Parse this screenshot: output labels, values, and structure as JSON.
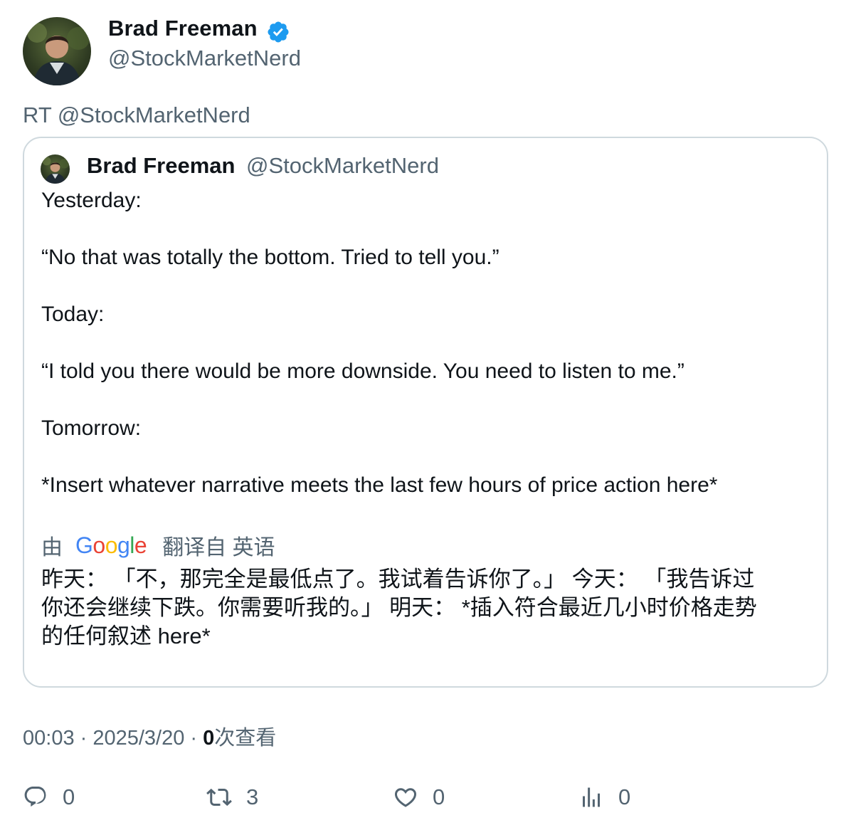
{
  "author": {
    "name": "Brad Freeman",
    "handle": "@StockMarketNerd",
    "verified": true
  },
  "retweet_label": "RT @StockMarketNerd",
  "quoted": {
    "name": "Brad Freeman",
    "handle": "@StockMarketNerd",
    "lines": [
      "Yesterday:",
      "“No that was totally the bottom. Tried to tell you.”",
      "Today:",
      "“I told you there would be more downside. You need to listen to me.”",
      "Tomorrow:",
      "*Insert whatever narrative meets the last few hours of price action here*"
    ],
    "translation": {
      "by_label": "由",
      "provider": "Google",
      "from_label": "翻译自 英语",
      "lines": [
        "昨天： 「不，那完全是最低点了。我试着告诉你了。」 今天： 「我告诉过",
        "你还会继续下跌。你需要听我的。」 明天： *插入符合最近几小时价格走势",
        "的任何叙述 here*"
      ]
    }
  },
  "meta": {
    "time": "00:03",
    "date": "2025/3/20",
    "views_count": "0",
    "views_label": "次查看"
  },
  "actions": {
    "reply_count": "0",
    "retweet_count": "3",
    "like_count": "0",
    "views_count": "0"
  },
  "colors": {
    "verified_badge": "#1d9bf0",
    "secondary_text": "#536471",
    "card_border": "#cfd9de"
  }
}
